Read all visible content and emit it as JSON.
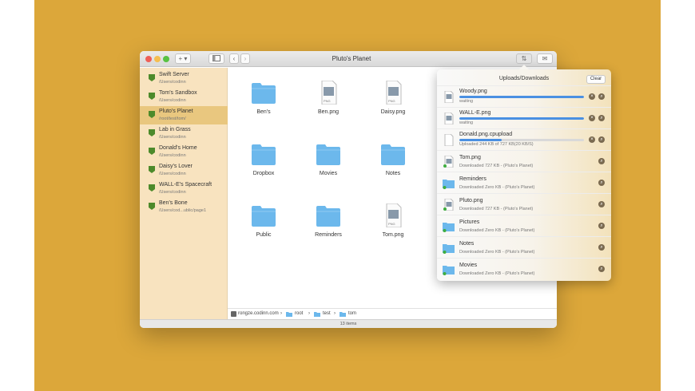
{
  "window": {
    "title": "Pluto's Planet"
  },
  "toolbar": {
    "add_label": "+ ▾",
    "sync_label": "⇅",
    "mail_label": "✉"
  },
  "sidebar": {
    "items": [
      {
        "name": "Swift Server",
        "path": "/Users/codinn"
      },
      {
        "name": "Tom's Sandbox",
        "path": "/Users/codinn"
      },
      {
        "name": "Pluto's Planet",
        "path": "/root/test/tom/"
      },
      {
        "name": "Lab in Grass",
        "path": "/Users/codinn"
      },
      {
        "name": "Donald's Home",
        "path": "/Users/codinn"
      },
      {
        "name": "Daisy's Lover",
        "path": "/Users/codinn"
      },
      {
        "name": "WALL-E's Spacecraft",
        "path": "/Users/codinn"
      },
      {
        "name": "Ben's Bone",
        "path": "/Users/cod...ublic/page1"
      }
    ]
  },
  "files": [
    {
      "name": "Ben's",
      "kind": "folder"
    },
    {
      "name": "Ben.png",
      "kind": "png"
    },
    {
      "name": "Daisy.png",
      "kind": "png"
    },
    {
      "name": "Dropbox",
      "kind": "folder"
    },
    {
      "name": "Movies",
      "kind": "folder"
    },
    {
      "name": "Notes",
      "kind": "folder"
    },
    {
      "name": "Public",
      "kind": "folder"
    },
    {
      "name": "Reminders",
      "kind": "folder"
    },
    {
      "name": "Tom.png",
      "kind": "png"
    }
  ],
  "png_badge": "PNG",
  "pathbar": {
    "host": "rongze.codinn.com",
    "seg1": "root",
    "seg2": "test",
    "seg3": "tom",
    "sep": "›"
  },
  "status": {
    "items_count": "13 items"
  },
  "transfers": {
    "title": "Uploads/Downloads",
    "clear_label": "Clear",
    "items": [
      {
        "name": "Woody.png",
        "status": "waiting",
        "progress": 1.0,
        "kind": "file"
      },
      {
        "name": "WALL-E.png",
        "status": "waiting",
        "progress": 1.0,
        "kind": "file"
      },
      {
        "name": "Donald.png.cpupload",
        "status": "Uploaded 244 KB of 727 KB(20 KB/S)",
        "progress": 0.34,
        "kind": "file"
      },
      {
        "name": "Tom.png",
        "status": "Downloaded 727 KB - (Pluto's Planet)",
        "kind": "file"
      },
      {
        "name": "Reminders",
        "status": "Downloaded Zero KB - (Pluto's Planet)",
        "kind": "folder"
      },
      {
        "name": "Pluto.png",
        "status": "Downloaded 727 KB - (Pluto's Planet)",
        "kind": "file"
      },
      {
        "name": "Pictures",
        "status": "Downloaded Zero KB - (Pluto's Planet)",
        "kind": "folder"
      },
      {
        "name": "Notes",
        "status": "Downloaded Zero KB - (Pluto's Planet)",
        "kind": "folder"
      },
      {
        "name": "Movies",
        "status": "Downloaded Zero KB - (Pluto's Planet)",
        "kind": "folder"
      }
    ]
  },
  "colors": {
    "backdrop": "#dca73a",
    "sidebar": "#f8e3bf",
    "sidebar_selected": "#e9c77f",
    "folder": "#6cb8ec",
    "progress": "#4a90e2"
  }
}
